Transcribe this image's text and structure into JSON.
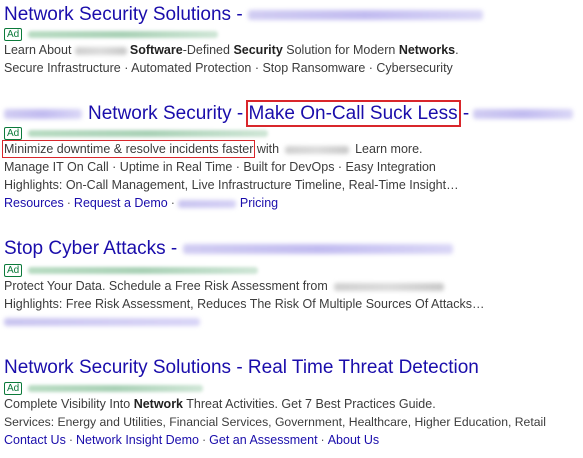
{
  "ads": [
    {
      "title_main": "Network Security Solutions",
      "title_sep": " - ",
      "ad_badge": "Ad",
      "desc": {
        "p1": "Learn About ",
        "p2": "Software",
        "p3": "-Defined ",
        "p4": "Security",
        "p5": " Solution for Modern ",
        "p6": "Networks",
        "p7": "."
      },
      "line2": "Secure Infrastructure · Automated Protection · Stop Ransomware · Cybersecurity"
    },
    {
      "title_main": "Network Security",
      "title_sep": " - ",
      "title_highlight": "Make On-Call Suck Less",
      "title_after": " -",
      "ad_badge": "Ad",
      "desc_highlight": "Minimize downtime & resolve incidents faster",
      "desc_with": " with",
      "desc_more": "Learn more.",
      "line2": "Manage IT On Call · Uptime in Real Time · Built for DevOps · Easy Integration",
      "line3": "Highlights: On-Call Management, Live Infrastructure Timeline, Real-Time Insight…",
      "links": {
        "resources": "Resources",
        "demo": "Request a Demo",
        "pricing": "Pricing"
      }
    },
    {
      "title_main": "Stop Cyber Attacks",
      "title_sep": " -",
      "ad_badge": "Ad",
      "desc_p1": "Protect Your Data. Schedule a Free Risk Assessment from",
      "line2": "Highlights: Free Risk Assessment, Reduces The Risk Of Multiple Sources Of Attacks…"
    },
    {
      "title_main": "Network Security Solutions - Real Time Threat Detection",
      "ad_badge": "Ad",
      "desc": {
        "p1": "Complete Visibility Into ",
        "p2": "Network",
        "p3": " Threat Activities. Get 7 Best Practices Guide."
      },
      "line2": "Services: Energy and Utilities, Financial Services, Government, Healthcare, Higher Education, Retail",
      "links": [
        "Contact Us",
        "Network Insight Demo",
        "Get an Assessment",
        "About Us"
      ]
    }
  ],
  "colors": {
    "title": "#1a0dab",
    "ad_badge": "#0b7a3a",
    "highlight_box": "#d9262b"
  }
}
